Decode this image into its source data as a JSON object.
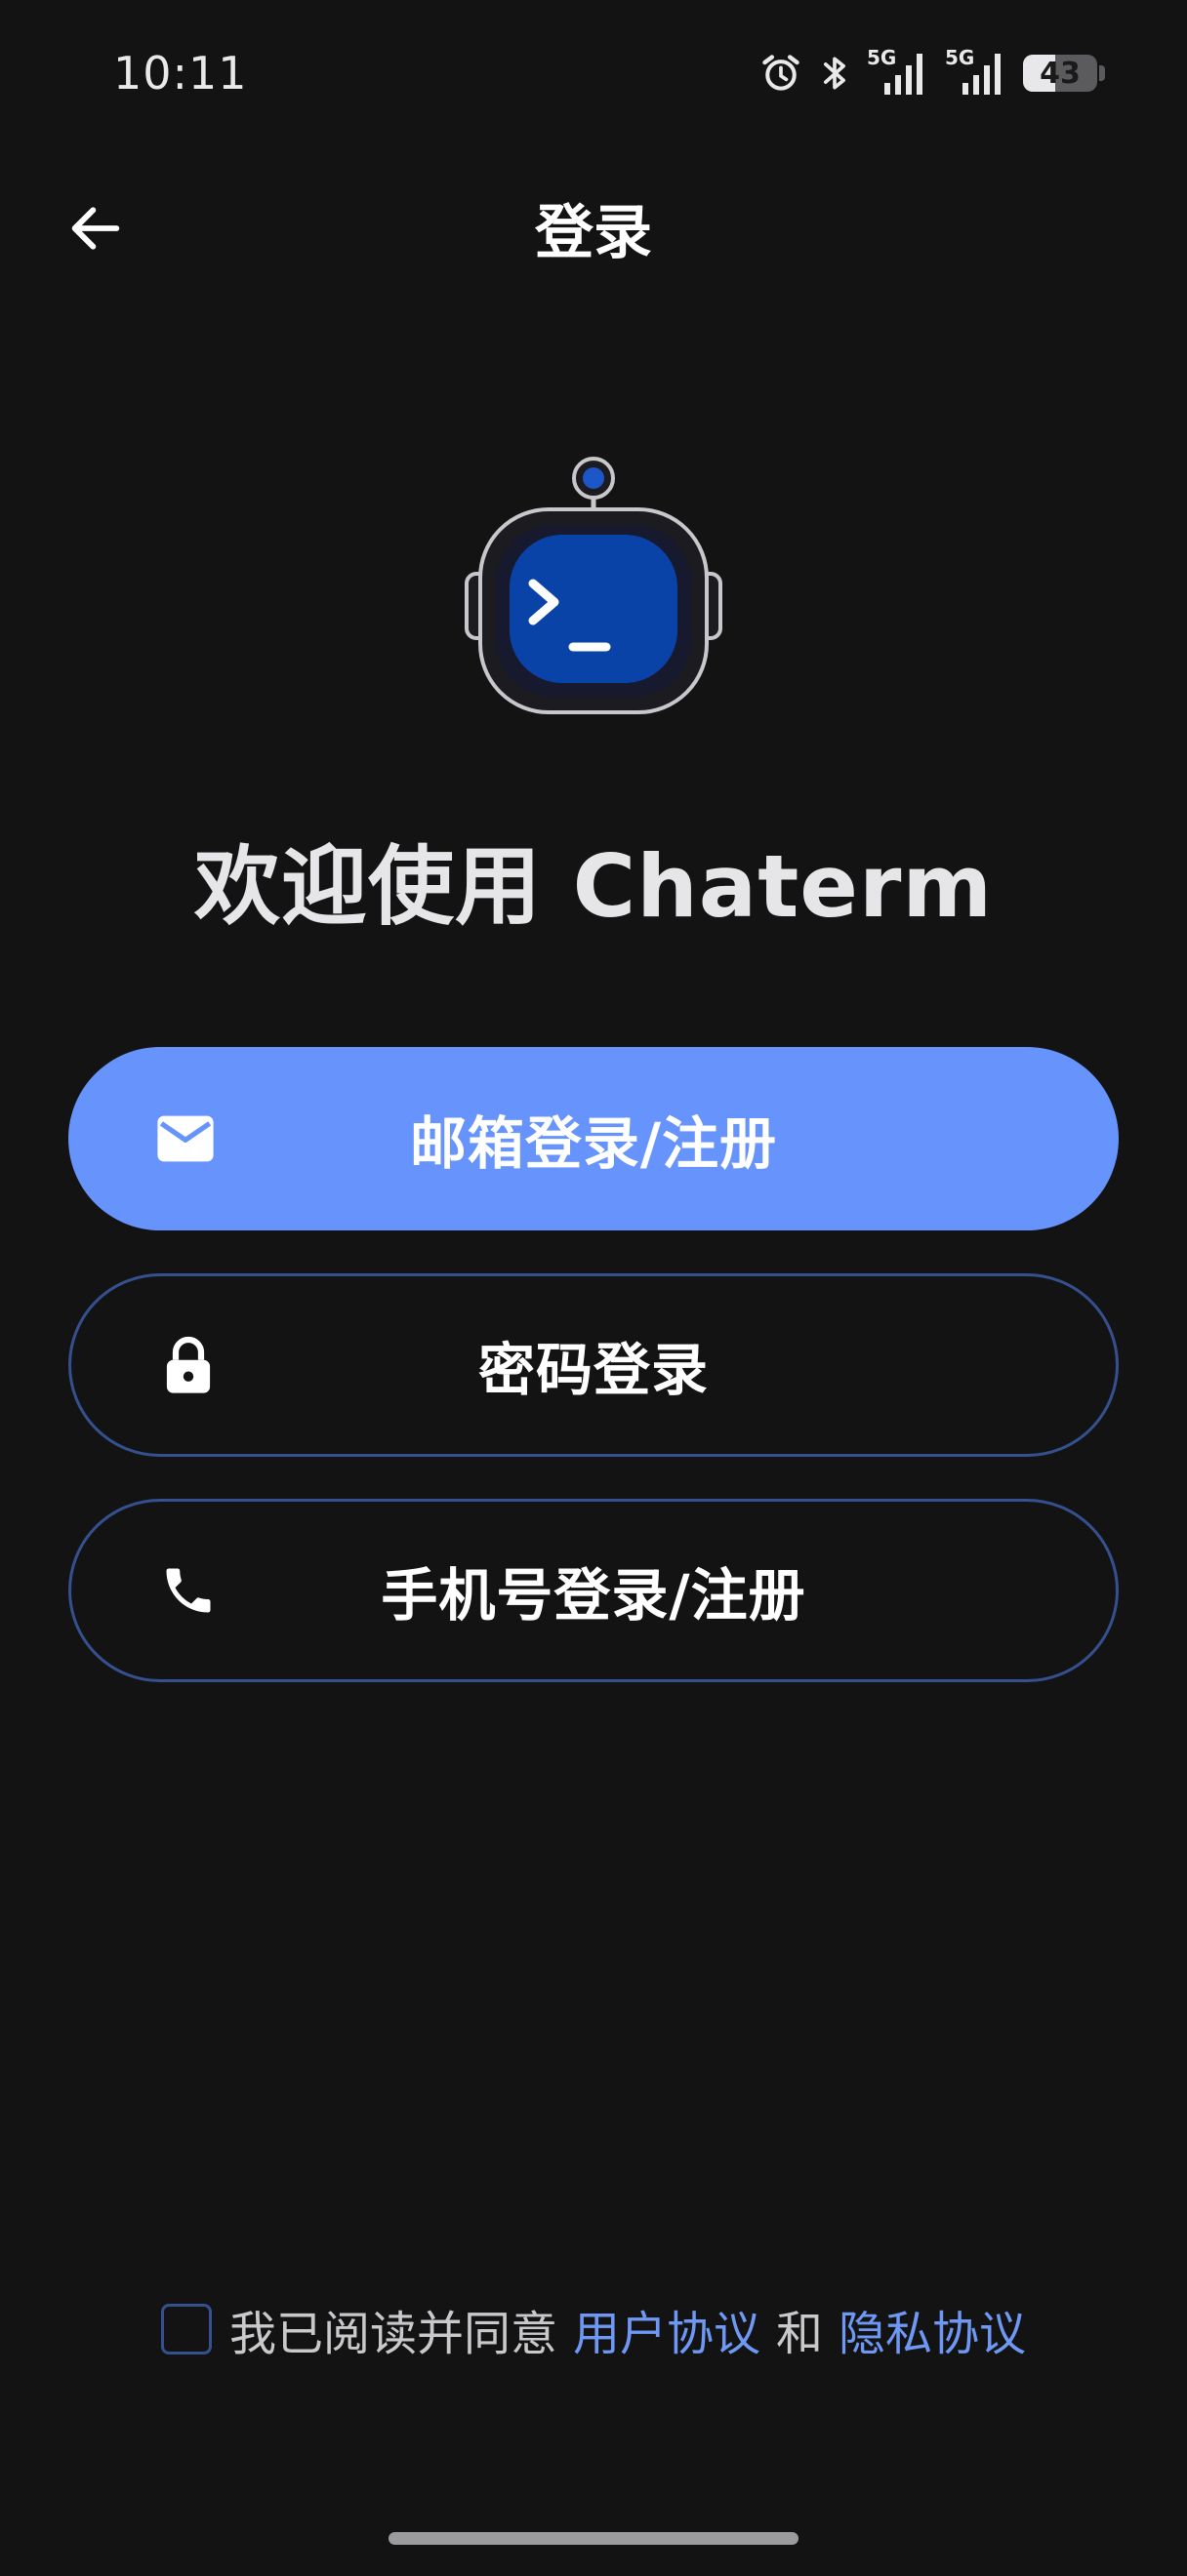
{
  "status_bar": {
    "time": "10:11",
    "icons": [
      "alarm-icon",
      "bluetooth-icon",
      "signal-5g-icon",
      "signal-5g-icon",
      "battery-icon"
    ],
    "network_label_1": "5G",
    "network_label_2": "5G",
    "battery_level": "43",
    "battery_fraction": 0.43
  },
  "header": {
    "title": "登录",
    "back_icon": "arrow-left-icon"
  },
  "welcome_text": "欢迎使用 Chaterm",
  "buttons": {
    "email": {
      "label": "邮箱登录/注册",
      "icon": "mail-icon"
    },
    "password": {
      "label": "密码登录",
      "icon": "lock-icon"
    },
    "phone": {
      "label": "手机号登录/注册",
      "icon": "phone-icon"
    }
  },
  "agreement": {
    "prefix": "我已阅读并同意",
    "user_agreement": "用户协议",
    "conjunction": "和",
    "privacy_policy": "隐私协议",
    "checked": false
  },
  "colors": {
    "background": "#131314",
    "primary": "#6694fc",
    "outline": "#35508e",
    "link": "#6f97f4"
  }
}
